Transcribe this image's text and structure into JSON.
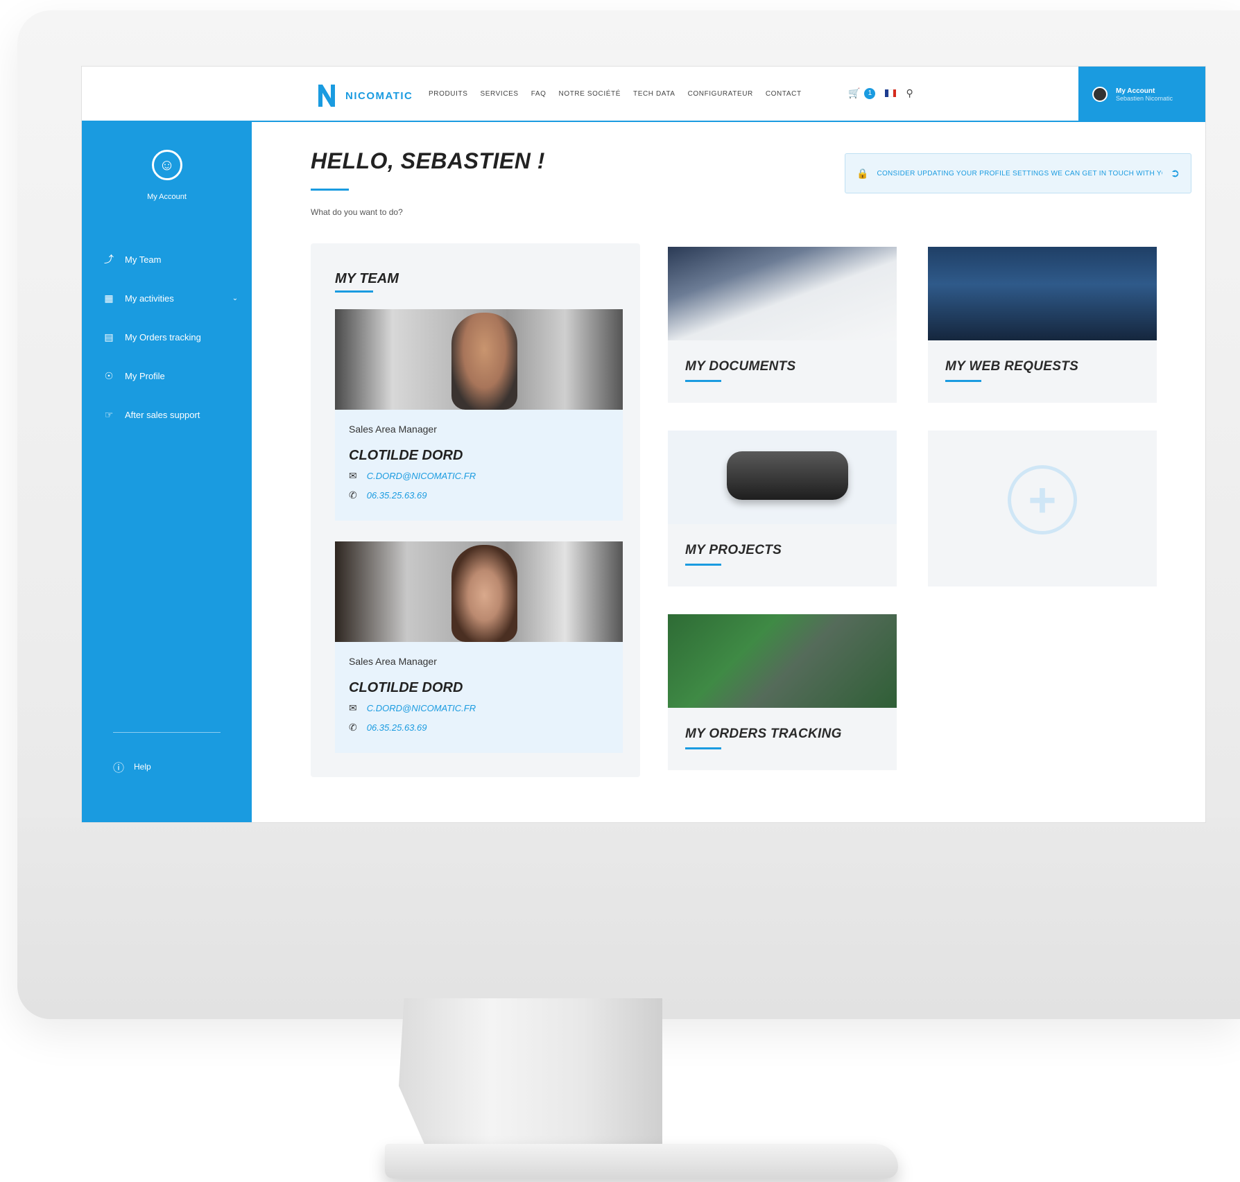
{
  "brand": {
    "logo_text": "NICOMATIC",
    "accent": "#1a9be0"
  },
  "nav": {
    "items": [
      "PRODUITS",
      "SERVICES",
      "FAQ",
      "NOTRE SOCIÉTÉ",
      "TECH DATA",
      "CONFIGURATEUR",
      "CONTACT"
    ],
    "cart_count": "1",
    "language": "FR",
    "icons": [
      "cart-icon",
      "flag-fr-icon",
      "search-icon"
    ]
  },
  "user": {
    "name": "My Account",
    "subtitle": "Sebastien Nicomatic"
  },
  "sidebar": {
    "account_label": "My Account",
    "items": [
      {
        "label": "My Team",
        "icon": "team-icon"
      },
      {
        "label": "My activities",
        "icon": "activities-icon"
      },
      {
        "label": "My Orders tracking",
        "icon": "orders-icon"
      },
      {
        "label": "My Profile",
        "icon": "profile-icon"
      },
      {
        "label": "After sales support",
        "icon": "support-icon"
      }
    ],
    "help_label": "Help"
  },
  "main": {
    "greeting": "HELLO, SEBASTIEN !",
    "subtitle": "What do you want to do?",
    "notice": "CONSIDER UPDATING YOUR PROFILE SETTINGS WE CAN GET IN TOUCH WITH YOU EASILY"
  },
  "team": {
    "title": "MY TEAM",
    "members": [
      {
        "role": "Sales Area Manager",
        "name": "CLOTILDE DORD",
        "email": "C.DORD@NICOMATIC.FR",
        "phone": "06.35.25.63.69"
      },
      {
        "role": "Sales Area Manager",
        "name": "CLOTILDE DORD",
        "email": "C.DORD@NICOMATIC.FR",
        "phone": "06.35.25.63.69"
      }
    ]
  },
  "tiles": {
    "documents": "MY DOCUMENTS",
    "web_requests": "MY WEB REQUESTS",
    "projects": "MY PROJECTS",
    "orders": "MY ORDERS TRACKING",
    "add": "+"
  }
}
